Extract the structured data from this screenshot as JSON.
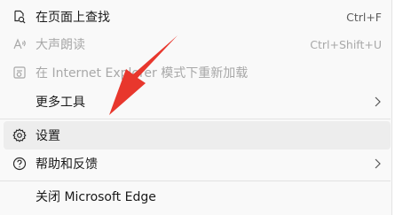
{
  "menu": {
    "items": [
      {
        "label": "在页面上查找",
        "shortcut": "Ctrl+F",
        "icon": "find-icon"
      },
      {
        "label": "大声朗读",
        "shortcut": "Ctrl+Shift+U",
        "icon": "read-aloud-icon"
      },
      {
        "label": "在 Internet Explorer 模式下重新加载",
        "icon": "ie-reload-icon"
      },
      {
        "label": "更多工具",
        "icon": "none"
      },
      {
        "label": "设置",
        "icon": "gear-icon"
      },
      {
        "label": "帮助和反馈",
        "icon": "help-icon"
      },
      {
        "label": "关闭 Microsoft Edge",
        "icon": "none"
      }
    ]
  },
  "colors": {
    "arrow": "#e8372d",
    "hover": "#ededed",
    "disabled_text": "#a8a8a8"
  }
}
